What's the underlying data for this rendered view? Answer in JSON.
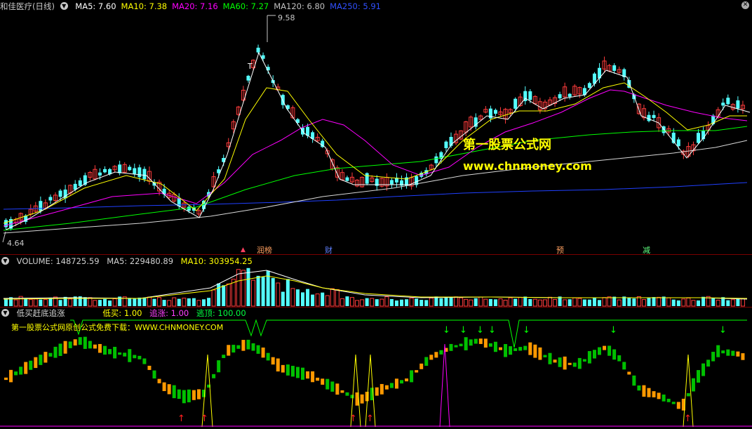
{
  "main_header": {
    "stock_title": "和佳医疗(日线)",
    "ma": [
      {
        "label": "MA5: 7.60",
        "color": "#ffffff"
      },
      {
        "label": "MA10: 7.38",
        "color": "#ffff00"
      },
      {
        "label": "MA20: 7.16",
        "color": "#ff00ff"
      },
      {
        "label": "MA60: 7.27",
        "color": "#00ff00"
      },
      {
        "label": "MA120: 6.80",
        "color": "#c0c0c0"
      },
      {
        "label": "MA250: 5.91",
        "color": "#3050ff"
      }
    ]
  },
  "price_panel": {
    "high_label": "9.58",
    "low_label": "4.64",
    "t_mark": "T",
    "events": [
      {
        "label": "▲",
        "color": "#ff4060"
      },
      {
        "label": "润榜",
        "color": "#ffa060"
      },
      {
        "label": "财",
        "color": "#6080ff"
      },
      {
        "label": "预",
        "color": "#ffa060"
      },
      {
        "label": "减",
        "color": "#60ff80"
      }
    ],
    "watermark_title": "第一股票公式网",
    "watermark_url": "www.chnmoney.com"
  },
  "volume_header": {
    "title": "VOLUME: 148725.59",
    "ma5": "MA5: 229480.89",
    "ma10": "MA10: 303954.25"
  },
  "indicator_header": {
    "title": "低买赶底追涨",
    "buy_label": "低买: 1.00",
    "chase_label": "追涨: 1.00",
    "escape_label": "逃顶: 100.00"
  },
  "indicator_panel": {
    "promo": "第一股票公式网原创公式免费下载：WWW.CHNMONEY.COM"
  },
  "colors": {
    "up": "#ff3c3c",
    "down": "#54ffff",
    "ma5": "#ffffff",
    "ma10": "#ffff00",
    "ma20": "#ff00ff",
    "ma60": "#00ff00",
    "ma120": "#d8d8d8",
    "ma250": "#2040ff",
    "indicator_orange": "#ff9900",
    "indicator_green": "#00c000"
  },
  "icons": [
    "chevron-down-icon",
    "close-icon",
    "up-arrow-icon",
    "down-arrow-icon"
  ]
}
